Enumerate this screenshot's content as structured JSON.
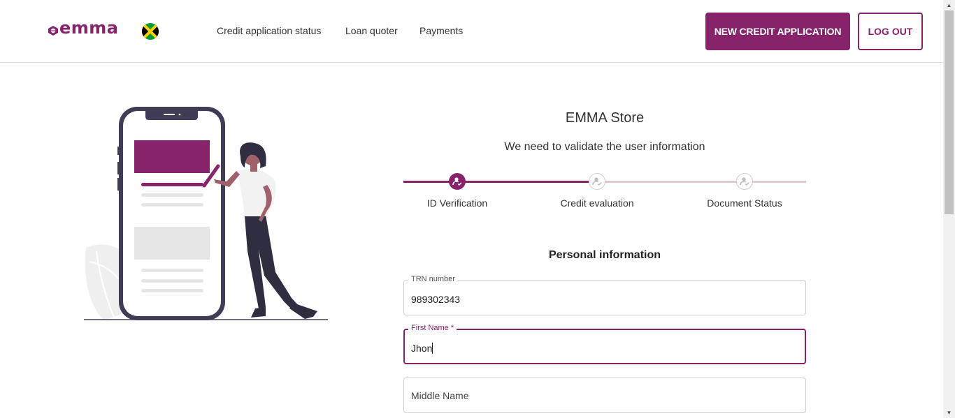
{
  "header": {
    "logo_text": "emma",
    "nav": [
      "Credit application status",
      "Loan quoter",
      "Payments"
    ],
    "new_application_label": "NEW CREDIT APPLICATION",
    "logout_label": "LOG OUT"
  },
  "main": {
    "store_name": "EMMA Store",
    "subtitle": "We need to validate the user information",
    "steps": [
      {
        "label": "ID Verification",
        "state": "active"
      },
      {
        "label": "Credit evaluation",
        "state": "pending"
      },
      {
        "label": "Document Status",
        "state": "pending"
      }
    ],
    "section_title": "Personal information",
    "fields": {
      "trn": {
        "label": "TRN number",
        "value": "989302343"
      },
      "first_name": {
        "label": "First Name",
        "required_mark": "*",
        "value": "Jhon"
      },
      "middle_name": {
        "placeholder": "Middle Name"
      }
    }
  },
  "colors": {
    "brand": "#86236b",
    "brand_light": "#e3c6d7",
    "flag_green": "#009b3a",
    "flag_gold": "#fed100"
  },
  "icons": [
    "emma-logo-icon",
    "jamaica-flag-icon",
    "user-check-icon"
  ]
}
